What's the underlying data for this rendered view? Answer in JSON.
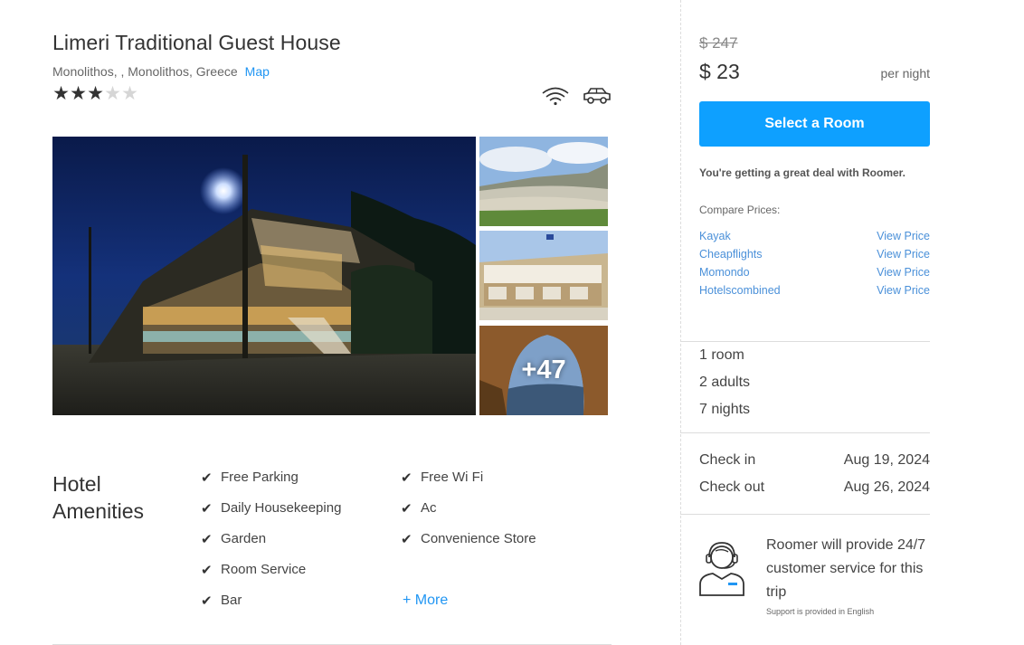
{
  "hotel": {
    "name": "Limeri Traditional Guest House",
    "address": "Monolithos, , Monolithos, Greece",
    "map_label": "Map",
    "stars": [
      "★",
      "★",
      "★",
      "★",
      "★"
    ],
    "rating": 3,
    "features": [
      "wifi-icon",
      "car-icon"
    ]
  },
  "gallery": {
    "more_count": "+47"
  },
  "amenities": {
    "title": "Hotel Amenities",
    "col1": [
      "Free Parking",
      "Daily Housekeeping",
      "Garden",
      "Room Service",
      "Bar"
    ],
    "col2": [
      "Free Wi Fi",
      "Ac",
      "Convenience Store"
    ],
    "more_label": "+ More"
  },
  "pricing": {
    "old_price": "$ 247",
    "price": "$ 23",
    "per_night": "per night",
    "select_label": "Select a Room",
    "deal_text": "You're getting a great deal with Roomer.",
    "compare_label": "Compare Prices:",
    "providers": [
      {
        "name": "Kayak",
        "action": "View Price"
      },
      {
        "name": "Cheapflights",
        "action": "View Price"
      },
      {
        "name": "Momondo",
        "action": "View Price"
      },
      {
        "name": "Hotelscombined",
        "action": "View Price"
      }
    ]
  },
  "booking": {
    "rooms": "1 room",
    "adults": "2 adults",
    "nights": "7 nights",
    "checkin_label": "Check in",
    "checkin_date": "Aug 19, 2024",
    "checkout_label": "Check out",
    "checkout_date": "Aug 26, 2024"
  },
  "support": {
    "text": "Roomer will provide 24/7 customer service for this trip",
    "note": "Support is provided in English"
  },
  "colors": {
    "accent": "#0ea0ff",
    "link": "#2196f3"
  }
}
